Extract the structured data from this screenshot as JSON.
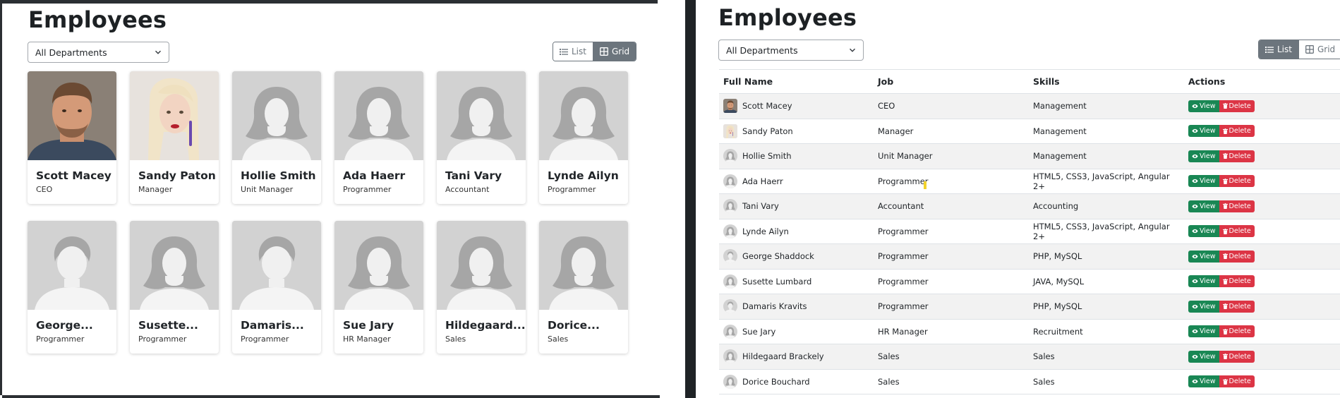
{
  "left": {
    "title": "Employees",
    "department_filter": "All Departments",
    "view_toggle": {
      "list_label": "List",
      "grid_label": "Grid",
      "active": "Grid"
    },
    "cards": [
      {
        "name": "Scott Macey",
        "job": "CEO",
        "photo": "man-photo"
      },
      {
        "name": "Sandy Paton",
        "job": "Manager",
        "photo": "woman-photo"
      },
      {
        "name": "Hollie Smith",
        "job": "Unit Manager",
        "photo": "female-placeholder"
      },
      {
        "name": "Ada Haerr",
        "job": "Programmer",
        "photo": "female-placeholder"
      },
      {
        "name": "Tani Vary",
        "job": "Accountant",
        "photo": "female-placeholder"
      },
      {
        "name": "Lynde Ailyn",
        "job": "Programmer",
        "photo": "female-placeholder"
      },
      {
        "name": "George...",
        "job": "Programmer",
        "photo": "male-placeholder"
      },
      {
        "name": "Susette...",
        "job": "Programmer",
        "photo": "female-placeholder"
      },
      {
        "name": "Damaris...",
        "job": "Programmer",
        "photo": "male-placeholder"
      },
      {
        "name": "Sue Jary",
        "job": "HR Manager",
        "photo": "female-placeholder"
      },
      {
        "name": "Hildegaard...",
        "job": "Sales",
        "photo": "female-placeholder"
      },
      {
        "name": "Dorice...",
        "job": "Sales",
        "photo": "female-placeholder"
      }
    ]
  },
  "right": {
    "title": "Employees",
    "department_filter": "All Departments",
    "view_toggle": {
      "list_label": "List",
      "grid_label": "Grid",
      "active": "List"
    },
    "columns": [
      "Full Name",
      "Job",
      "Skills",
      "Actions"
    ],
    "view_label": "View",
    "delete_label": "Delete",
    "rows": [
      {
        "name": "Scott Macey",
        "job": "CEO",
        "skills": "Management",
        "avatar": "man-photo"
      },
      {
        "name": "Sandy Paton",
        "job": "Manager",
        "skills": "Management",
        "avatar": "woman-photo"
      },
      {
        "name": "Hollie Smith",
        "job": "Unit Manager",
        "skills": "Management",
        "avatar": "female-placeholder"
      },
      {
        "name": "Ada Haerr",
        "job": "Programmer",
        "skills": "HTML5, CSS3, JavaScript, Angular 2+",
        "avatar": "female-placeholder"
      },
      {
        "name": "Tani Vary",
        "job": "Accountant",
        "skills": "Accounting",
        "avatar": "female-placeholder"
      },
      {
        "name": "Lynde Ailyn",
        "job": "Programmer",
        "skills": "HTML5, CSS3, JavaScript, Angular 2+",
        "avatar": "female-placeholder"
      },
      {
        "name": "George Shaddock",
        "job": "Programmer",
        "skills": "PHP, MySQL",
        "avatar": "male-placeholder"
      },
      {
        "name": "Susette Lumbard",
        "job": "Programmer",
        "skills": "JAVA, MySQL",
        "avatar": "female-placeholder"
      },
      {
        "name": "Damaris Kravits",
        "job": "Programmer",
        "skills": "PHP, MySQL",
        "avatar": "male-placeholder"
      },
      {
        "name": "Sue Jary",
        "job": "HR Manager",
        "skills": "Recruitment",
        "avatar": "female-placeholder"
      },
      {
        "name": "Hildegaard Brackely",
        "job": "Sales",
        "skills": "Sales",
        "avatar": "female-placeholder"
      },
      {
        "name": "Dorice Bouchard",
        "job": "Sales",
        "skills": "Sales",
        "avatar": "female-placeholder"
      }
    ]
  },
  "colors": {
    "view_button": "#198754",
    "delete_button": "#dc3545",
    "toggle_active": "#6c757d",
    "placeholder_bg": "#d2d2d2"
  }
}
